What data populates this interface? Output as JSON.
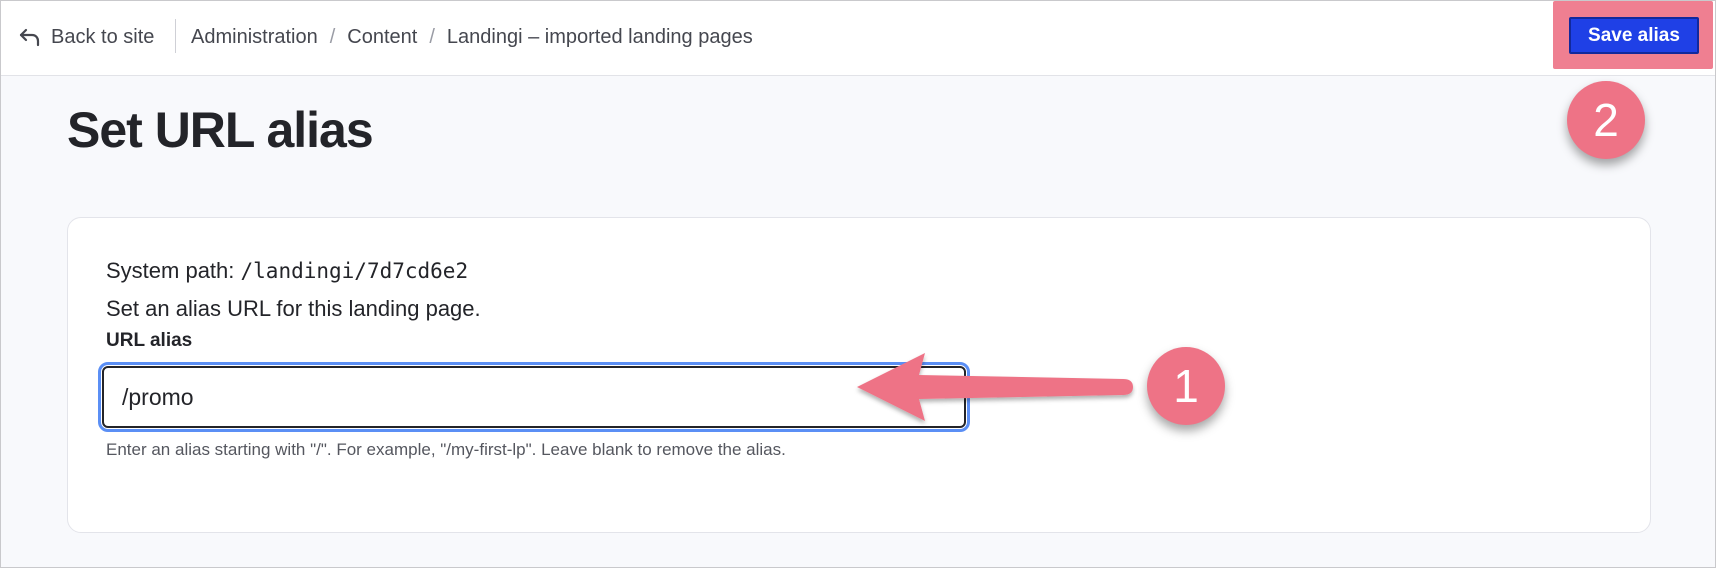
{
  "toolbar": {
    "back_label": "Back to site",
    "breadcrumbs": [
      {
        "label": "Administration"
      },
      {
        "label": "Content"
      },
      {
        "label": "Landingi – imported landing pages"
      }
    ],
    "breadcrumb_separator": "/",
    "save_label": "Save alias",
    "back_icon": "return-arrow-icon"
  },
  "page": {
    "title": "Set URL alias"
  },
  "form": {
    "system_path_label": "System path:",
    "system_path_value": "/landingi/7d7cd6e2",
    "intro": "Set an alias URL for this landing page.",
    "field_label": "URL alias",
    "field_value": "/promo",
    "field_description": "Enter an alias starting with \"/\". For example, \"/my-first-lp\". Leave blank to remove the alias."
  },
  "annotations": {
    "step1": "1",
    "step2": "2",
    "color": "#ee7386"
  },
  "colors": {
    "primary_button": "#1f40e6",
    "focus_ring": "#5b8ff5",
    "annotation": "#ee7386"
  }
}
